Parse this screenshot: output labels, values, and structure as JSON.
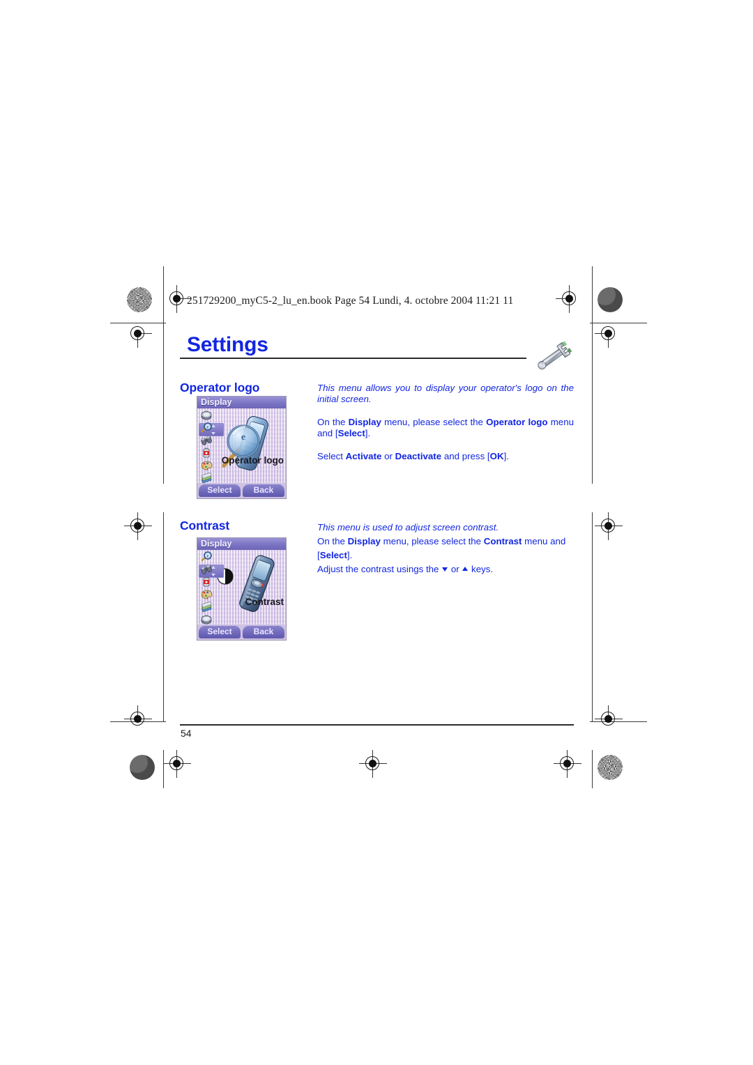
{
  "document": {
    "book_line": "251729200_myC5-2_lu_en.book  Page 54  Lundi, 4. octobre 2004  11:21 11",
    "chapter_title": "Settings",
    "page_number": "54",
    "chapter_icon": "wrench-icon"
  },
  "colors": {
    "heading_blue": "#1226e0",
    "body_blue": "#1226e0",
    "rule_black": "#2b2b2b",
    "phone_titlebar": "#7b74c4",
    "phone_screen": "#d6c6ea"
  },
  "sections": [
    {
      "id": "operator-logo",
      "heading": "Operator logo",
      "paragraphs": [
        {
          "style": "italic",
          "runs": [
            {
              "text": "This menu allows you to display your operator's logo on the initial screen.",
              "bold": false
            }
          ]
        },
        {
          "style": "normal",
          "runs": [
            {
              "text": "On the ",
              "bold": false
            },
            {
              "text": "Display",
              "bold": true
            },
            {
              "text": " menu, please select the ",
              "bold": false
            },
            {
              "text": "Operator logo",
              "bold": true
            },
            {
              "text": " menu and [",
              "bold": false
            },
            {
              "text": "Select",
              "bold": true
            },
            {
              "text": "].",
              "bold": false
            }
          ]
        },
        {
          "style": "normal",
          "runs": [
            {
              "text": "Select ",
              "bold": false
            },
            {
              "text": "Activate",
              "bold": true
            },
            {
              "text": " or ",
              "bold": false
            },
            {
              "text": "Deactivate",
              "bold": true
            },
            {
              "text": " and press [",
              "bold": false
            },
            {
              "text": "OK",
              "bold": true
            },
            {
              "text": "].",
              "bold": false
            }
          ]
        }
      ],
      "screenshot": {
        "titlebar": "Display",
        "menu_label": "Operator logo",
        "softkey_left": "Select",
        "softkey_right": "Back",
        "selected_index": 1,
        "rail_icons": [
          "alarm-clock-icon",
          "magnifier-icon",
          "binoculars-icon",
          "battery-icon",
          "palette-icon",
          "layers-icon"
        ],
        "art": "phone-with-magnifier-illustration"
      }
    },
    {
      "id": "contrast",
      "heading": "Contrast",
      "paragraphs": [
        {
          "style": "italic",
          "runs": [
            {
              "text": "This menu is used to adjust screen contrast.",
              "bold": false
            }
          ]
        },
        {
          "style": "normal",
          "runs": [
            {
              "text": "On the ",
              "bold": false
            },
            {
              "text": "Display",
              "bold": true
            },
            {
              "text": " menu, please select the ",
              "bold": false
            },
            {
              "text": "Contrast",
              "bold": true
            },
            {
              "text": " menu and [",
              "bold": false
            },
            {
              "text": "Select",
              "bold": true
            },
            {
              "text": "].",
              "bold": false
            }
          ]
        },
        {
          "style": "keys",
          "prefix": "Adjust the contrast usings the ",
          "middle": " or ",
          "suffix": " keys."
        }
      ],
      "screenshot": {
        "titlebar": "Display",
        "menu_label": "Contrast",
        "softkey_left": "Select",
        "softkey_right": "Back",
        "selected_index": 1,
        "rail_icons": [
          "magnifier-icon",
          "binoculars-icon",
          "battery-icon",
          "palette-icon",
          "layers-icon",
          "alarm-clock-icon"
        ],
        "art": "phone-with-contrast-circle-illustration"
      }
    }
  ]
}
